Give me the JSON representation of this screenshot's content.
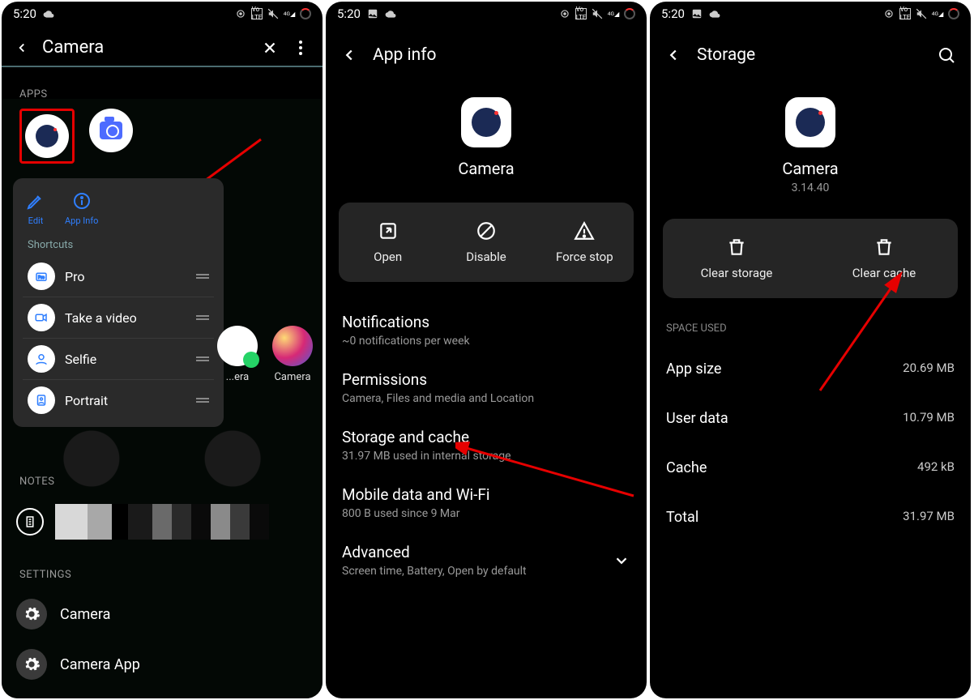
{
  "status": {
    "time": "5:20"
  },
  "screen1": {
    "search_text": "Camera",
    "apps_label": "APPS",
    "popup": {
      "edit": "Edit",
      "appinfo": "App Info",
      "shortcuts_label": "Shortcuts",
      "items": [
        {
          "label": "Pro"
        },
        {
          "label": "Take a video"
        },
        {
          "label": "Selfie"
        },
        {
          "label": "Portrait"
        }
      ]
    },
    "side_apps": [
      {
        "label": "...era"
      },
      {
        "label": "Camera"
      }
    ],
    "notes_label": "NOTES",
    "settings_label": "SETTINGS",
    "settings": [
      {
        "label": "Camera"
      },
      {
        "label": "Camera App"
      }
    ]
  },
  "screen2": {
    "header": "App info",
    "app_name": "Camera",
    "actions": {
      "open": "Open",
      "disable": "Disable",
      "force_stop": "Force stop"
    },
    "items": [
      {
        "title": "Notifications",
        "sub": "~0 notifications per week"
      },
      {
        "title": "Permissions",
        "sub": "Camera, Files and media and Location"
      },
      {
        "title": "Storage and cache",
        "sub": "31.97 MB used in internal storage"
      },
      {
        "title": "Mobile data and Wi-Fi",
        "sub": "800 B used since 9 Mar"
      },
      {
        "title": "Advanced",
        "sub": "Screen time, Battery, Open by default"
      }
    ]
  },
  "screen3": {
    "header": "Storage",
    "app_name": "Camera",
    "version": "3.14.40",
    "actions": {
      "clear_storage": "Clear storage",
      "clear_cache": "Clear cache"
    },
    "space_used_label": "SPACE USED",
    "rows": [
      {
        "key": "App size",
        "val": "20.69 MB"
      },
      {
        "key": "User data",
        "val": "10.79 MB"
      },
      {
        "key": "Cache",
        "val": "492 kB"
      },
      {
        "key": "Total",
        "val": "31.97 MB"
      }
    ]
  }
}
